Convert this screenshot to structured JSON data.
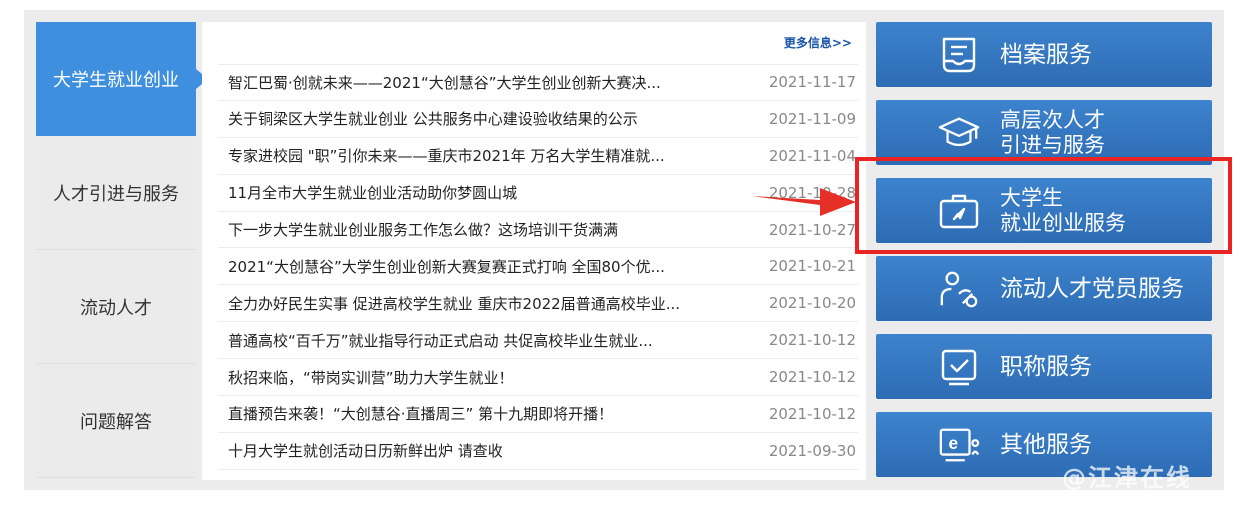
{
  "tabs": [
    {
      "label": "大学生就业创业",
      "active": true
    },
    {
      "label": "人才引进与服务",
      "active": false
    },
    {
      "label": "流动人才",
      "active": false
    },
    {
      "label": "问题解答",
      "active": false
    }
  ],
  "news": {
    "more_label": "更多信息>>",
    "items": [
      {
        "title": "智汇巴蜀·创就未来——2021“大创慧谷”大学生创业创新大赛决...",
        "date": "2021-11-17"
      },
      {
        "title": "关于铜梁区大学生就业创业 公共服务中心建设验收结果的公示",
        "date": "2021-11-09"
      },
      {
        "title": "专家进校园 \"职”引你未来——重庆市2021年 万名大学生精准就...",
        "date": "2021-11-04"
      },
      {
        "title": "11月全市大学生就业创业活动助你梦圆山城",
        "date": "2021-10-28"
      },
      {
        "title": "下一步大学生就业创业服务工作怎么做？这场培训干货满满",
        "date": "2021-10-27"
      },
      {
        "title": "2021“大创慧谷”大学生创业创新大赛复赛正式打响 全国80个优...",
        "date": "2021-10-21"
      },
      {
        "title": "全力办好民生实事 促进高校学生就业 重庆市2022届普通高校毕业...",
        "date": "2021-10-20"
      },
      {
        "title": "普通高校“百千万”就业指导行动正式启动 共促高校毕业生就业...",
        "date": "2021-10-12"
      },
      {
        "title": "秋招来临，“带岗实训营”助力大学生就业！",
        "date": "2021-10-12"
      },
      {
        "title": "直播预告来袭！“大创慧谷·直播周三” 第十九期即将开播！",
        "date": "2021-10-12"
      },
      {
        "title": "十月大学生就创活动日历新鲜出炉 请查收",
        "date": "2021-09-30"
      }
    ]
  },
  "services": [
    {
      "lines": [
        "档案服务"
      ],
      "icon": "archive-icon"
    },
    {
      "lines": [
        "高层次人才",
        "引进与服务"
      ],
      "icon": "graduation-cap-icon"
    },
    {
      "lines": [
        "大学生",
        "就业创业服务"
      ],
      "icon": "briefcase-icon"
    },
    {
      "lines": [
        "流动人才党员服务"
      ],
      "icon": "party-member-icon"
    },
    {
      "lines": [
        "职称服务"
      ],
      "icon": "checkbox-icon"
    },
    {
      "lines": [
        "其他服务"
      ],
      "icon": "e-service-icon"
    }
  ],
  "watermark": "@江津在线",
  "colors": {
    "accent": "#3f8fe0",
    "service_bg": "#2f70b8",
    "highlight": "#ea2323"
  }
}
